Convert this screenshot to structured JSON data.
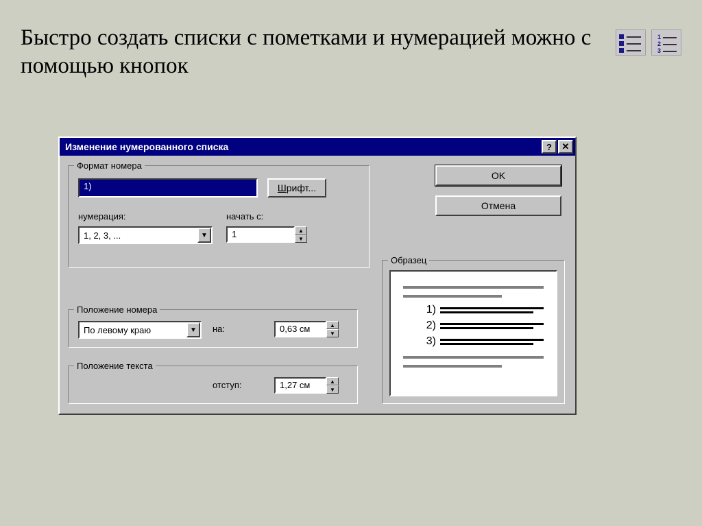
{
  "header": {
    "text": "Быстро создать списки с пометками и нумерацией можно с помощью кнопок"
  },
  "dialog": {
    "title": "Изменение нумерованного списка",
    "helpBtn": "?",
    "closeBtn": "✕",
    "format": {
      "groupLabel": "Формат номера",
      "numberValue": "1)",
      "fontBtnPrefix": "Ш",
      "fontBtnRest": "рифт...",
      "numberingLabel": "нумерация:",
      "numberingValue": "1, 2, 3, ...",
      "startLabel": "начать с:",
      "startValue": "1"
    },
    "positionNumber": {
      "groupLabel": "Положение номера",
      "alignValue": "По левому краю",
      "atLabel": "на:",
      "atValue": "0,63 см"
    },
    "positionText": {
      "groupLabel": "Положение текста",
      "indentLabel": "отступ:",
      "indentValue": "1,27 см"
    },
    "sample": {
      "groupLabel": "Образец",
      "items": [
        "1)",
        "2)",
        "3)"
      ]
    },
    "okBtn": "OK",
    "cancelBtn": "Отмена"
  }
}
